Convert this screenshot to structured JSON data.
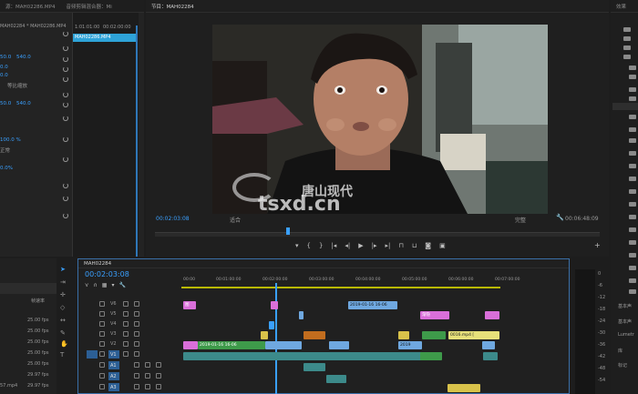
{
  "source_panel": {
    "tabs": [
      "源：MAH02286.MP4",
      "音频剪辑混合器：Mi"
    ],
    "clip_header": "MAH02284 * MAH02286.MP4",
    "mini_timecodes": [
      "1:01:01:00",
      "00:02:00:00"
    ],
    "mini_clip_name": "MAH02286.MP4",
    "values": [
      "50.0",
      "540.0",
      "0.0",
      "0.0",
      "50.0",
      "540.0",
      "100.0 %",
      "0.0%"
    ],
    "labels": [
      "等比缩放",
      "正常",
      "正常"
    ]
  },
  "program_monitor": {
    "tab_title": "节目：MAH02284",
    "timecode_current": "00:02:03:08",
    "fit_dropdown": "适合",
    "quality_dropdown": "完整",
    "timecode_duration": "00:06:48:09"
  },
  "watermark": {
    "chinese_text": "唐山现代",
    "latin_text": "tsxd.cn"
  },
  "project_panel": {
    "tab_title": "效果",
    "label_1": "基本声",
    "label_2": "基本声",
    "label_3": "Lumetr",
    "label_4": "库",
    "label_5": "标记"
  },
  "project_bin": {
    "header": "帧速率",
    "rates": [
      "25.00 fps",
      "25.00 fps",
      "25.00 fps",
      "25.00 fps",
      "25.00 fps",
      "29.97 fps",
      "29.97 fps",
      "29.97 fps"
    ],
    "filename": "57.mp4"
  },
  "timeline": {
    "tab_title": "MAH02284",
    "timecode": "00:02:03:08",
    "ruler": [
      "00:00",
      "00:01:00:00",
      "00:02:00:00",
      "00:03:00:00",
      "00:04:00:00",
      "00:05:00:00",
      "00:06:00:00",
      "00:07:00:00"
    ],
    "tracks": [
      "V6",
      "V5",
      "V4",
      "V3",
      "V2",
      "V1",
      "A1",
      "A2",
      "A3",
      "A4"
    ],
    "clip_labels": [
      "2019-01-16 16-06",
      "渐隐",
      "2019-01-16 16-06",
      "2019",
      "0016.mp4 [",
      "2019",
      "图"
    ]
  },
  "audio_meter": {
    "scale": [
      "0",
      "-6",
      "-12",
      "-18",
      "-24",
      "-30",
      "-36",
      "-42",
      "-48",
      "-54"
    ]
  },
  "colors": {
    "accent": "#3aa0ff",
    "pink": "#d96fd9",
    "green": "#3e9a4a",
    "teal": "#3c8a8a",
    "lightblue": "#6fa8e0",
    "yellow": "#d8c24a",
    "orange": "#c26d1e"
  }
}
